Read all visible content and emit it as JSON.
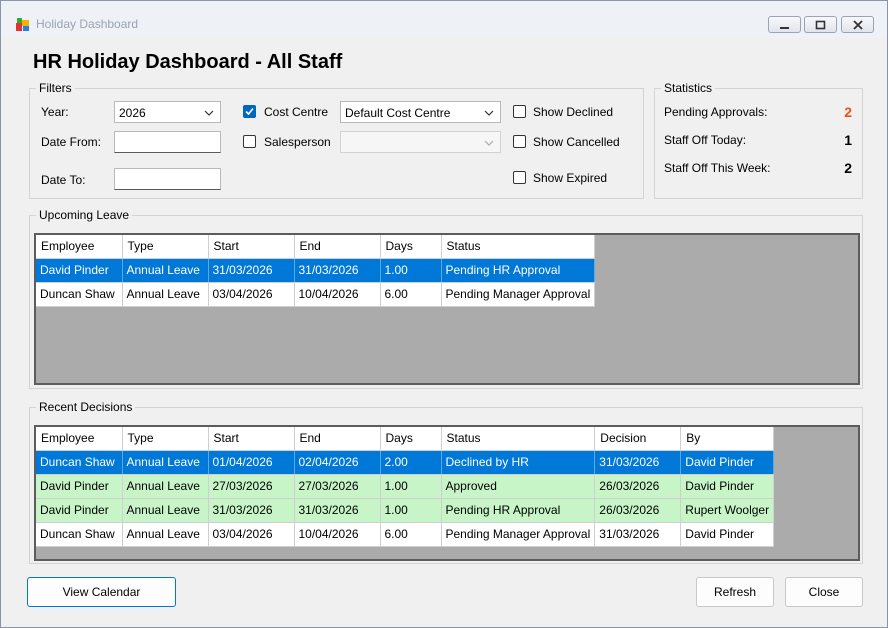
{
  "window": {
    "title": "Holiday Dashboard"
  },
  "page_title": "HR Holiday Dashboard - All Staff",
  "filters": {
    "legend": "Filters",
    "year_label": "Year:",
    "year_value": "2026",
    "date_from_label": "Date From:",
    "date_from_value": "",
    "date_to_label": "Date To:",
    "date_to_value": "",
    "cost_centre_label": "Cost Centre",
    "cost_centre_checked": true,
    "cost_centre_value": "Default Cost Centre",
    "salesperson_label": "Salesperson",
    "salesperson_checked": false,
    "salesperson_value": "",
    "show_declined_label": "Show Declined",
    "show_cancelled_label": "Show Cancelled",
    "show_expired_label": "Show Expired"
  },
  "statistics": {
    "legend": "Statistics",
    "pending_label": "Pending Approvals:",
    "pending_value": "2",
    "pending_color": "#e8501c",
    "off_today_label": "Staff Off Today:",
    "off_today_value": "1",
    "off_week_label": "Staff Off This Week:",
    "off_week_value": "2"
  },
  "upcoming": {
    "legend": "Upcoming Leave",
    "columns": [
      "Employee",
      "Type",
      "Start",
      "End",
      "Days",
      "Status"
    ],
    "rows": [
      [
        "David Pinder",
        "Annual Leave",
        "31/03/2026",
        "31/03/2026",
        "1.00",
        "Pending HR Approval"
      ],
      [
        "Duncan Shaw",
        "Annual Leave",
        "03/04/2026",
        "10/04/2026",
        "6.00",
        "Pending Manager Approval"
      ]
    ],
    "row_styles": [
      "sel",
      "plain"
    ]
  },
  "decisions": {
    "legend": "Recent Decisions",
    "columns": [
      "Employee",
      "Type",
      "Start",
      "End",
      "Days",
      "Status",
      "Decision",
      "By"
    ],
    "rows": [
      [
        "Duncan Shaw",
        "Annual Leave",
        "01/04/2026",
        "02/04/2026",
        "2.00",
        "Declined by HR",
        "31/03/2026",
        "David Pinder"
      ],
      [
        "David Pinder",
        "Annual Leave",
        "27/03/2026",
        "27/03/2026",
        "1.00",
        "Approved",
        "26/03/2026",
        "David Pinder"
      ],
      [
        "David Pinder",
        "Annual Leave",
        "31/03/2026",
        "31/03/2026",
        "1.00",
        "Pending HR Approval",
        "26/03/2026",
        "Rupert Woolger"
      ],
      [
        "Duncan Shaw",
        "Annual Leave",
        "03/04/2026",
        "10/04/2026",
        "6.00",
        "Pending Manager Approval",
        "31/03/2026",
        "David Pinder"
      ]
    ],
    "row_styles": [
      "sel",
      "green",
      "green",
      "plain"
    ]
  },
  "buttons": {
    "view_calendar": "View Calendar",
    "refresh": "Refresh",
    "close": "Close"
  },
  "colors": {
    "selection": "#0078d7",
    "approved_row": "#c8f5c8",
    "grid_bg": "#ababab"
  }
}
